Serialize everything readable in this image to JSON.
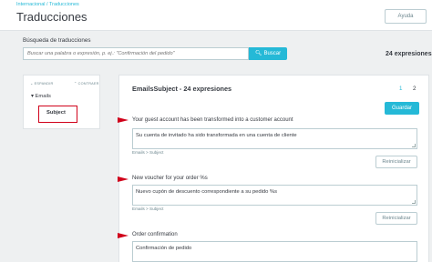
{
  "header": {
    "breadcrumb": "Internacional / Traducciones",
    "title": "Traducciones",
    "help_label": "Ayuda"
  },
  "search": {
    "label": "Búsqueda de traducciones",
    "placeholder": "Buscar una palabra o expresión, p. ej.: \"Confirmación del pedido\"",
    "button_label": "Buscar",
    "button_icon": "search-icon",
    "result_count": "24 expresiones"
  },
  "sidebar": {
    "expand_label": "ESPANDIR",
    "collapse_label": "CONTRAER",
    "tree": {
      "parent": "Emails",
      "child": "Subject"
    }
  },
  "main": {
    "title": "EmailsSubject - 24 expresiones",
    "pages": [
      "1",
      "2"
    ],
    "save_label": "Guardar",
    "entries": [
      {
        "source": "Your guest account has been transformed into a customer account",
        "translation": "Su cuenta de invitado ha sido transformada en una cuenta de cliente",
        "path": "Emails > Subject",
        "reset_label": "Reinicializar"
      },
      {
        "source": "New voucher for your order %s",
        "translation": "Nuevo cupón de descuento correspondiente a su pedido %s",
        "path": "Emails > Subject",
        "reset_label": "Reinicializar"
      },
      {
        "source": "Order confirmation",
        "translation": "Confirmación de pedido"
      }
    ]
  },
  "colors": {
    "accent": "#25b9d7",
    "annotation": "#d0021b",
    "background": "#eef0f1"
  }
}
